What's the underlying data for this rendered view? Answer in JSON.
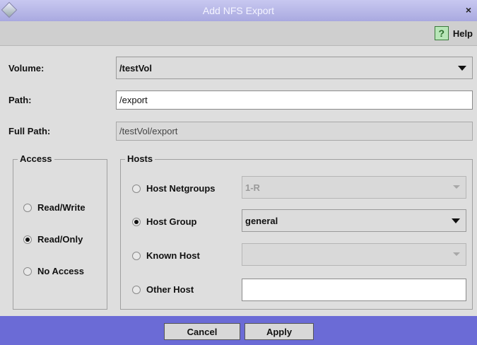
{
  "window": {
    "title": "Add NFS Export",
    "close_glyph": "×"
  },
  "help": {
    "icon_glyph": "?",
    "label": "Help"
  },
  "form": {
    "volume_label": "Volume:",
    "volume_value": "/testVol",
    "path_label": "Path:",
    "path_value": "/export",
    "full_path_label": "Full Path:",
    "full_path_value": "/testVol/export"
  },
  "access": {
    "title": "Access",
    "options": [
      {
        "label": "Read/Write",
        "selected": false
      },
      {
        "label": "Read/Only",
        "selected": true
      },
      {
        "label": "No Access",
        "selected": false
      }
    ]
  },
  "hosts": {
    "title": "Hosts",
    "options": [
      {
        "label": "Host Netgroups",
        "selected": false,
        "value": "1-R",
        "enabled": false
      },
      {
        "label": "Host Group",
        "selected": true,
        "value": "general",
        "enabled": true
      },
      {
        "label": "Known Host",
        "selected": false,
        "value": "",
        "enabled": false
      },
      {
        "label": "Other Host",
        "selected": false,
        "value": "",
        "enabled": true
      }
    ]
  },
  "buttons": {
    "cancel": "Cancel",
    "apply": "Apply"
  },
  "colors": {
    "titlebar": "#a9a9e0",
    "footer": "#6b6bd6",
    "help_icon": "#b8e6b8"
  }
}
